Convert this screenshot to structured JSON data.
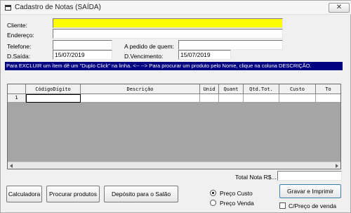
{
  "window": {
    "title": "Cadastro de Notas (SAÍDA)",
    "close_glyph": "✕"
  },
  "form": {
    "cliente_label": "Cliente:",
    "cliente_value": "",
    "endereco_label": "Endereço:",
    "endereco_value": "",
    "telefone_label": "Telefone:",
    "telefone_value": "",
    "pedido_label": "A pedido de quem:",
    "pedido_value": "",
    "dsaida_label": "D.Saída:",
    "dsaida_value": "15/07/2019",
    "dvencimento_label": "D.Vencimento:",
    "dvencimento_value": "15/07/2019"
  },
  "banner": "Para EXCLUIR um ítem dê um \"Duplo Click\" na linha. <-- --> Para procurar um produto pelo Nome, clique na coluna DESCRIÇÃO.",
  "grid": {
    "columns": [
      "",
      "CódigoDígito",
      "Descrição",
      "Unid",
      "Quant",
      "Qtd.Tot.",
      "Custo",
      "To"
    ],
    "rows": [
      [
        "1",
        "",
        "",
        "",
        "",
        "",
        "",
        ""
      ]
    ]
  },
  "total": {
    "label": "Total Nota R$...",
    "value": ""
  },
  "buttons": {
    "calculadora": "Calculadora",
    "procurar": "Procurar produtos",
    "deposito": "Depósito para o Salão",
    "gravar": "Gravar e Imprimir"
  },
  "price": {
    "options": [
      "Preço Custo",
      "Preço Venda"
    ],
    "selected": "Preço Custo",
    "checkbox_label": "C/Preço de venda",
    "checkbox_checked": false
  }
}
